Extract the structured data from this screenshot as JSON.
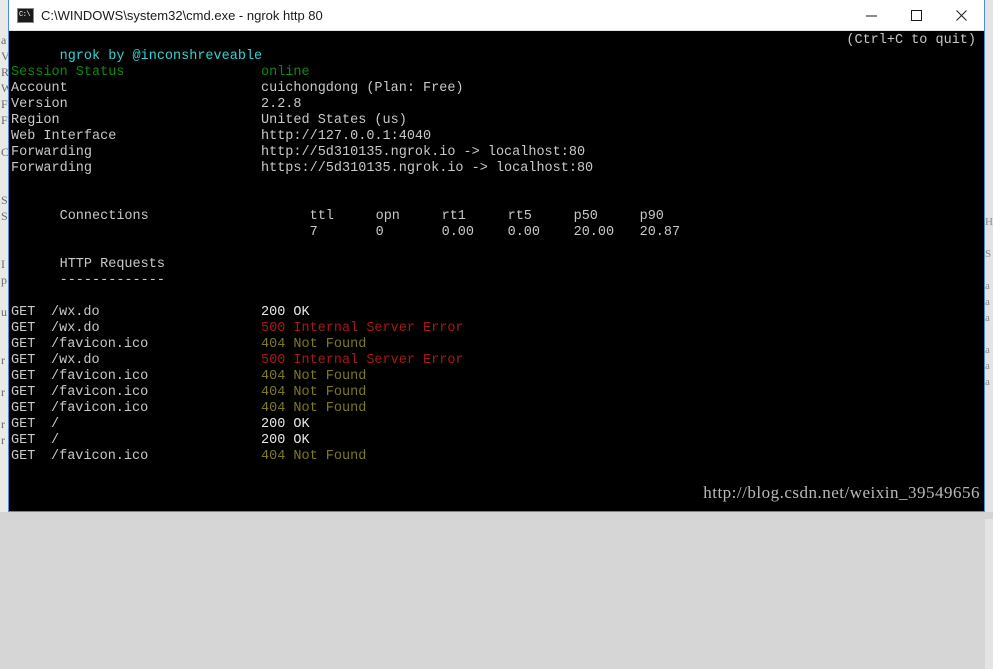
{
  "window": {
    "title": "C:\\WINDOWS\\system32\\cmd.exe - ngrok  http 80",
    "icon": "cmd-console-icon",
    "minimize_label": "—",
    "maximize_label": "□",
    "close_label": "✕"
  },
  "terminal": {
    "banner": "ngrok by @inconshreveable",
    "quit_hint": "(Ctrl+C to quit)",
    "session": [
      {
        "label": "Session Status",
        "value": "online",
        "style": "green"
      },
      {
        "label": "Account",
        "value": "cuichongdong (Plan: Free)",
        "style": "grey"
      },
      {
        "label": "Version",
        "value": "2.2.8",
        "style": "grey"
      },
      {
        "label": "Region",
        "value": "United States (us)",
        "style": "grey"
      },
      {
        "label": "Web Interface",
        "value": "http://127.0.0.1:4040",
        "style": "grey"
      },
      {
        "label": "Forwarding",
        "value": "http://5d310135.ngrok.io -> localhost:80",
        "style": "grey"
      },
      {
        "label": "Forwarding",
        "value": "https://5d310135.ngrok.io -> localhost:80",
        "style": "grey"
      }
    ],
    "connections": {
      "label": "Connections",
      "headers": [
        "ttl",
        "opn",
        "rt1",
        "rt5",
        "p50",
        "p90"
      ],
      "values": [
        "7",
        "0",
        "0.00",
        "0.00",
        "20.00",
        "20.87"
      ]
    },
    "http_requests": {
      "heading": "HTTP Requests",
      "divider": "-------------",
      "rows": [
        {
          "method": "GET",
          "path": "/wx.do",
          "status": "200 OK",
          "style": "white"
        },
        {
          "method": "GET",
          "path": "/wx.do",
          "status": "500 Internal Server Error",
          "style": "red"
        },
        {
          "method": "GET",
          "path": "/favicon.ico",
          "status": "404 Not Found",
          "style": "olive"
        },
        {
          "method": "GET",
          "path": "/wx.do",
          "status": "500 Internal Server Error",
          "style": "red"
        },
        {
          "method": "GET",
          "path": "/favicon.ico",
          "status": "404 Not Found",
          "style": "olive"
        },
        {
          "method": "GET",
          "path": "/favicon.ico",
          "status": "404 Not Found",
          "style": "olive"
        },
        {
          "method": "GET",
          "path": "/favicon.ico",
          "status": "404 Not Found",
          "style": "olive"
        },
        {
          "method": "GET",
          "path": "/",
          "status": "200 OK",
          "style": "white"
        },
        {
          "method": "GET",
          "path": "/",
          "status": "200 OK",
          "style": "white"
        },
        {
          "method": "GET",
          "path": "/favicon.ico",
          "status": "404 Not Found",
          "style": "olive"
        }
      ]
    }
  },
  "watermark": {
    "text": "http://blog.csdn.net/weixin_39549656"
  },
  "background_windows": {
    "left_fragments": [
      "",
      "",
      "a",
      "V",
      "R",
      "W",
      "F",
      "F",
      "",
      "C",
      "",
      "",
      "S",
      "S",
      "",
      "",
      "I",
      "p",
      "",
      "u",
      "",
      "",
      "r",
      "",
      "r",
      "",
      "r",
      "r"
    ],
    "right_fragments": [
      "",
      "",
      "",
      "",
      "H",
      "",
      "S",
      "",
      "a",
      "a",
      "a",
      "",
      "a",
      "a",
      "a",
      "",
      "",
      ""
    ]
  },
  "colors": {
    "background": "#000000",
    "cyan": "#2fd4d4",
    "green": "#0b8a0b",
    "white": "#e8e8e8",
    "red": "#a81818",
    "olive": "#7e7a1c",
    "grey": "#c8c8c8",
    "window_border": "#4a8fd6",
    "titlebar": "#ffffff"
  }
}
